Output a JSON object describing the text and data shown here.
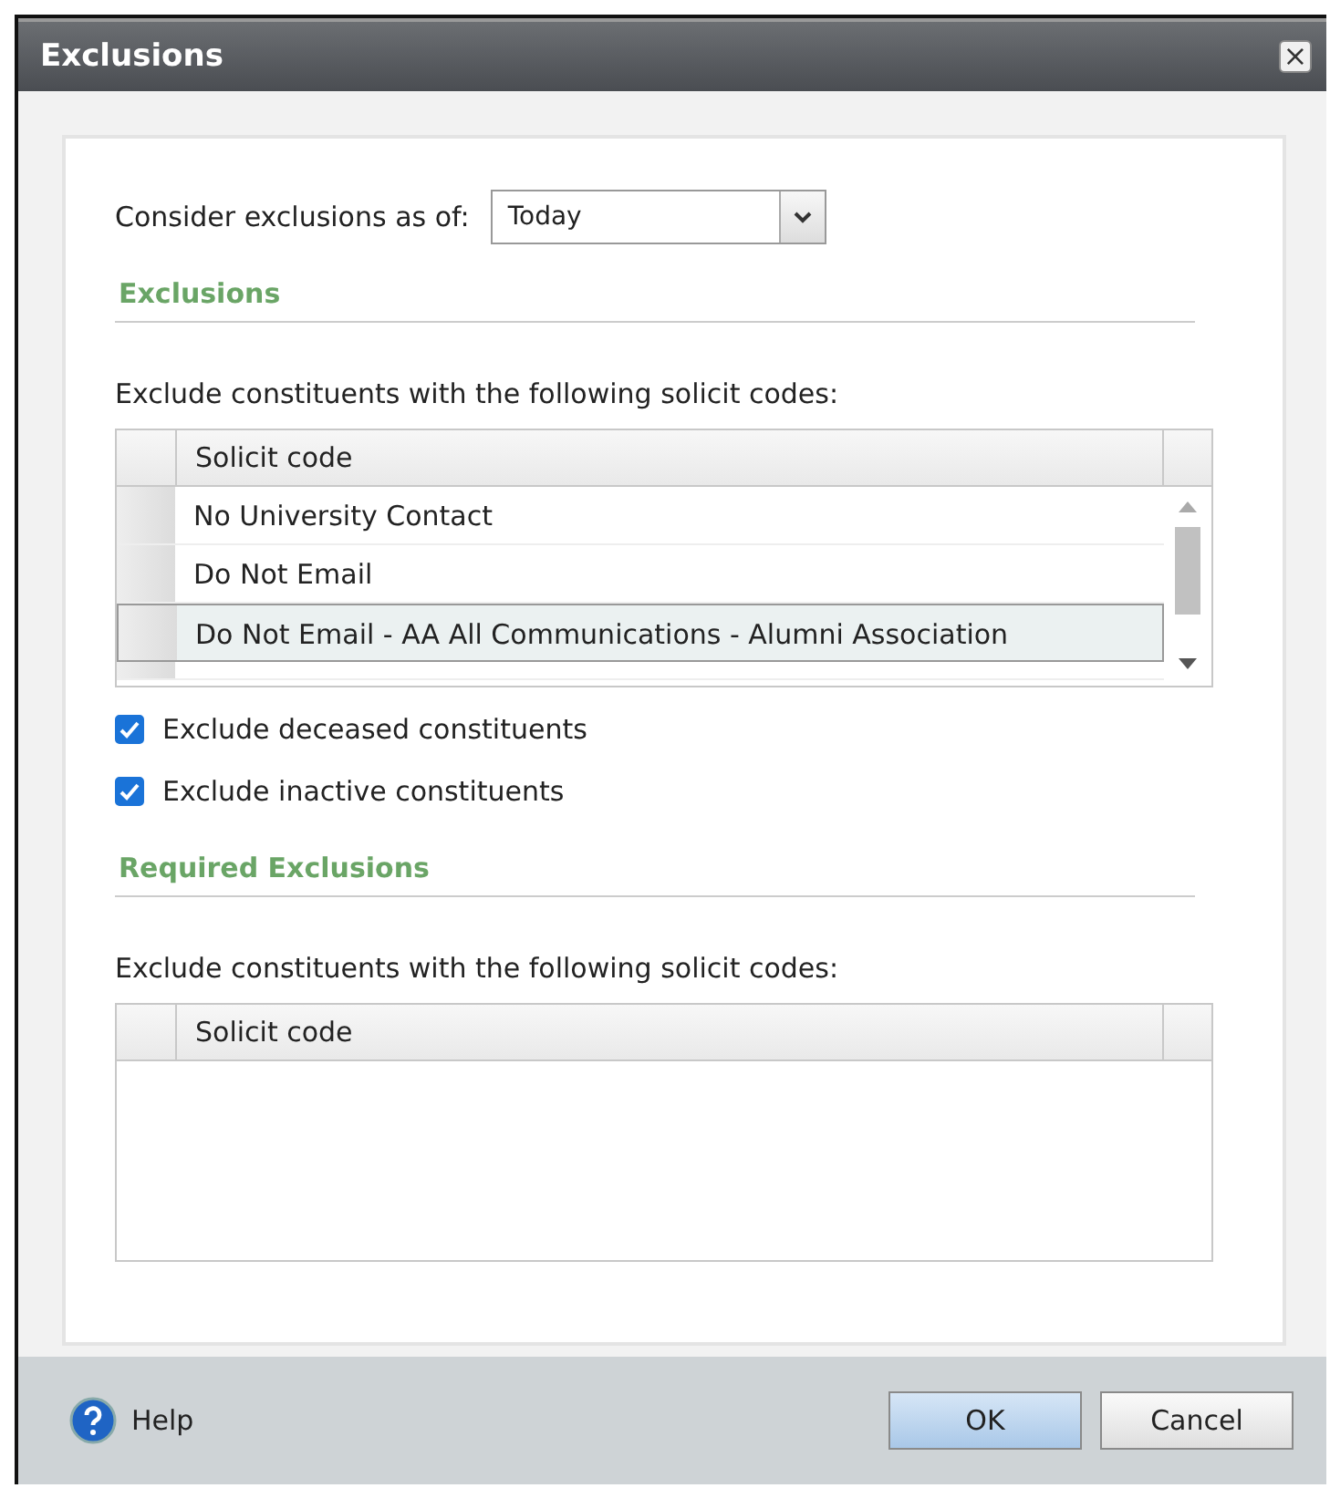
{
  "window": {
    "title": "Exclusions",
    "close": "×"
  },
  "as_of": {
    "label": "Consider exclusions as of:",
    "value": "Today"
  },
  "exclusions": {
    "heading": "Exclusions",
    "instruction": "Exclude constituents with the following solicit codes:",
    "columns": [
      "Solicit code"
    ],
    "rows": [
      {
        "solicit_code": "No University Contact",
        "selected": false
      },
      {
        "solicit_code": "Do Not Email",
        "selected": false
      },
      {
        "solicit_code": "Do Not Email - AA All Communications - Alumni Association",
        "selected": true
      }
    ]
  },
  "options": [
    {
      "label": "Exclude deceased constituents",
      "checked": true
    },
    {
      "label": "Exclude inactive constituents",
      "checked": true
    }
  ],
  "required_exclusions": {
    "heading": "Required Exclusions",
    "instruction": "Exclude constituents with the following solicit codes:",
    "columns": [
      "Solicit code"
    ]
  },
  "footer": {
    "help": "Help",
    "buttons": [
      {
        "label": "OK",
        "kind": "primary"
      },
      {
        "label": "Cancel",
        "kind": "secondary"
      }
    ]
  }
}
